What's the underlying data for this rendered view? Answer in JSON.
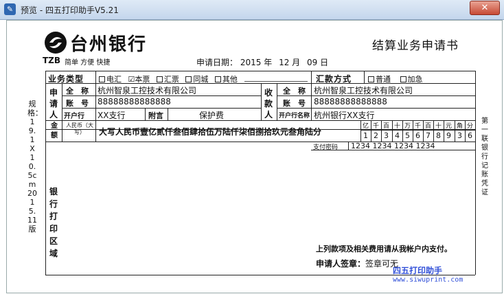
{
  "window": {
    "title": "预览 - 四五打印助手V5.21",
    "close_label": "✕",
    "icon": "app-icon"
  },
  "bank": {
    "logo_text": "台州银行",
    "abbr": "TZB",
    "slogan": "简单 方便 快捷"
  },
  "form": {
    "title": "结算业务申请书",
    "date_label": "申请日期：",
    "year": "2015",
    "year_unit": "年",
    "month": "12",
    "month_unit": "月",
    "day": "09",
    "day_unit": "日",
    "side_left": "规格：19.1X10.5cm 2015.11版",
    "side_right": "第一联 银行记账凭证",
    "service_type_label": "业务类型",
    "service_types": [
      "电汇",
      "本票",
      "汇票",
      "同城",
      "其他"
    ],
    "service_types_checked": [
      "本票"
    ],
    "remit_method_label": "汇款方式",
    "remit_methods": [
      "普通",
      "加急"
    ],
    "applicant_label": "申请人",
    "payee_label": "收款人",
    "name_label": "全　称",
    "account_label": "账　号",
    "bank_label": "开户行",
    "bank_name_label": "开户行名称",
    "memo_label": "附言",
    "applicant_name": "杭州智泉工控技术有限公司",
    "applicant_account": "88888888888888",
    "applicant_bank": "XX支行",
    "memo": "保护费",
    "payee_name": "杭州智泉工控技术有限公司",
    "payee_account": "88888888888888",
    "payee_bank": "杭州银行XX支行",
    "amount_label": "金额",
    "currency_label": "人民币（大写）",
    "amount_words": "大写人民币壹亿贰仟叁佰肆拾伍万陆仟柒佰捌拾玖元叁角陆分",
    "digit_units": [
      "亿",
      "千",
      "百",
      "十",
      "万",
      "千",
      "百",
      "十",
      "元",
      "角",
      "分"
    ],
    "digits": [
      "1",
      "2",
      "3",
      "4",
      "5",
      "6",
      "7",
      "8",
      "9",
      "3",
      "6"
    ],
    "password_label": "支付密码",
    "password": "1234 1234 1234 1234",
    "print_area": "银行打印区域",
    "statement": "上列款项及相关费用请从我帐户内支付。",
    "signature_label": "申请人签章：",
    "signature_value": "签章可无",
    "watermark_title": "四五打印助手",
    "watermark_url": "www.siwuprint.com"
  }
}
